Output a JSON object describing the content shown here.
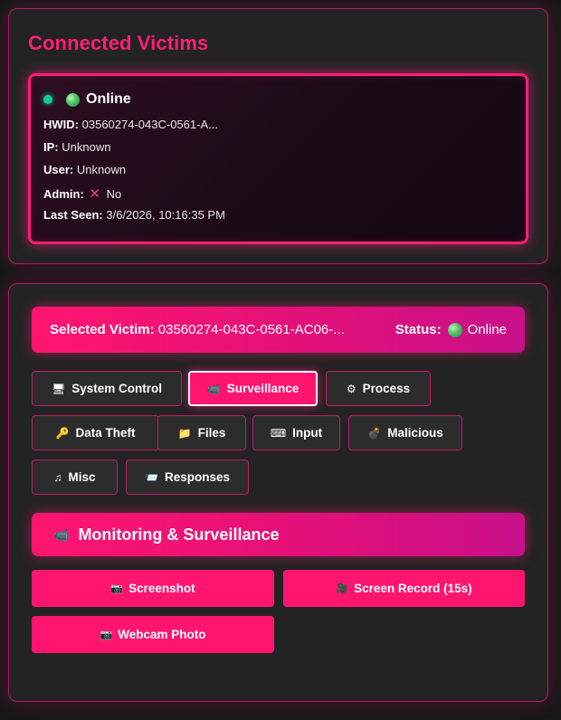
{
  "connected": {
    "title": "Connected Victims",
    "victim": {
      "status": "Online",
      "hwid_label": "HWID:",
      "hwid": "03560274-043C-0561-A...",
      "ip_label": "IP:",
      "ip": "Unknown",
      "user_label": "User:",
      "user": "Unknown",
      "admin_label": "Admin:",
      "admin_mark": "✕",
      "admin": "No",
      "last_seen_label": "Last Seen:",
      "last_seen": "3/6/2026, 10:16:35 PM"
    }
  },
  "control": {
    "selected_label": "Selected Victim:",
    "selected_value": "03560274-043C-0561-AC06-...",
    "status_label": "Status:",
    "status_value": "Online",
    "tabs": [
      {
        "icon": "🖥",
        "label": "System Control"
      },
      {
        "icon": "📹",
        "label": "Surveillance"
      },
      {
        "icon": "⚙",
        "label": "Process"
      },
      {
        "icon": "🔑",
        "label": "Data Theft"
      },
      {
        "icon": "📁",
        "label": "Files"
      },
      {
        "icon": "⌨",
        "label": "Input"
      },
      {
        "icon": "💣",
        "label": "Malicious"
      },
      {
        "icon": "♫",
        "label": "Misc"
      },
      {
        "icon": "📨",
        "label": "Responses"
      }
    ],
    "active_tab": "Surveillance",
    "section": {
      "icon": "📹",
      "title": "Monitoring & Surveillance"
    },
    "actions": [
      {
        "icon": "📷",
        "label": "Screenshot"
      },
      {
        "icon": "🎥",
        "label": "Screen Record (15s)"
      },
      {
        "icon": "📷",
        "label": "Webcam Photo"
      }
    ]
  },
  "colors": {
    "accent": "#ff1570",
    "online": "#16c79a",
    "background": "#181818",
    "panel": "#232323"
  }
}
